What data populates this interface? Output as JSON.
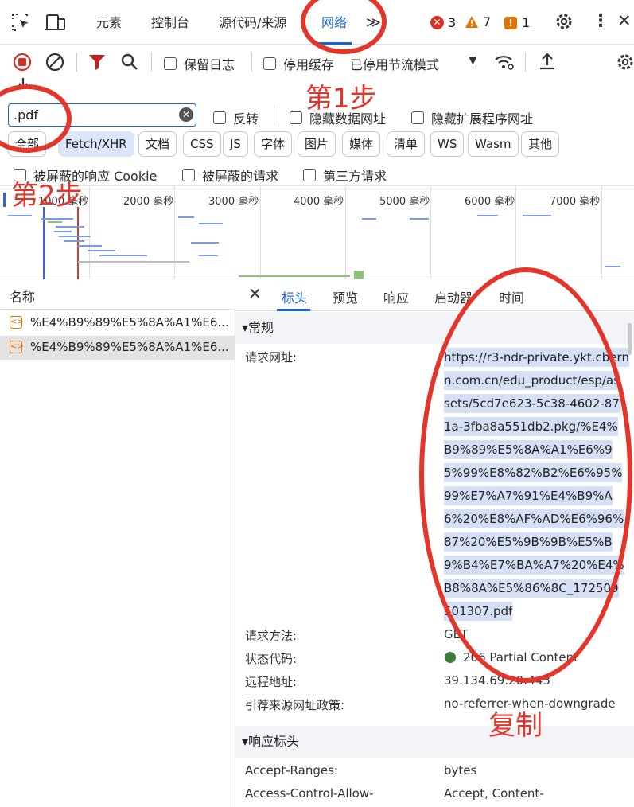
{
  "toolbar": {
    "tabs": [
      "元素",
      "控制台",
      "源代码/来源",
      "网络"
    ],
    "active_tab": "网络",
    "errors": "3",
    "warnings": "7",
    "issues": "1"
  },
  "network_toolbar": {
    "preserve_log": "保留日志",
    "disable_cache": "停用缓存",
    "throttling": "已停用节流模式"
  },
  "filter": {
    "value": ".pdf",
    "invert": "反转",
    "hide_data_urls": "隐藏数据网址",
    "hide_ext_urls": "隐藏扩展程序网址",
    "types": [
      "全部",
      "Fetch/XHR",
      "文档",
      "CSS",
      "JS",
      "字体",
      "图片",
      "媒体",
      "清单",
      "WS",
      "Wasm",
      "其他"
    ],
    "active_type": "Fetch/XHR",
    "blocked_cookies": "被屏蔽的响应 Cookie",
    "blocked_requests": "被屏蔽的请求",
    "third_party": "第三方请求"
  },
  "timeline": {
    "ticks": [
      "1000 毫秒",
      "2000 毫秒",
      "3000 毫秒",
      "4000 毫秒",
      "5000 毫秒",
      "6000 毫秒",
      "7000 毫秒"
    ]
  },
  "request_list": {
    "header": "名称",
    "rows": [
      "%E4%B9%89%E5%8A%A1%E6...",
      "%E4%B9%89%E5%8A%A1%E6..."
    ]
  },
  "details": {
    "tabs": [
      "标头",
      "预览",
      "响应",
      "启动器",
      "时间"
    ],
    "active_tab": "标头",
    "general": {
      "title": "▾常规",
      "url_label": "请求网址:",
      "url_lines": [
        "https://r3-ndr-private.ykt.cbern",
        "n.com.cn/edu_product/esp/as",
        "sets/5cd7e623-5c38-4602-87",
        "1a-3fba8a551db2.pkg/%E4%",
        "B9%89%E5%8A%A1%E6%9",
        "5%99%E8%82%B2%E6%95%",
        "99%E7%A7%91%E4%B9%A",
        "6%20%E8%AF%AD%E6%96%",
        "87%20%E5%9B%9B%E5%B",
        "9%B4%E7%BA%A7%20%E4%",
        "B8%8A%E5%86%8C_172509",
        "501307.pdf"
      ],
      "method_label": "请求方法:",
      "method": "GET",
      "status_label": "状态代码:",
      "status": "206 Partial Content",
      "status_color": "#3f7c3a",
      "remote_label": "远程地址:",
      "remote": "39.134.69.20:443",
      "referrer_label": "引荐来源网址政策:",
      "referrer": "no-referrer-when-downgrade"
    },
    "response_headers": {
      "title": "▾响应标头",
      "rows": [
        {
          "k": "Accept-Ranges:",
          "v": "bytes"
        },
        {
          "k": "Access-Control-Allow-",
          "v": "Accept, Content-"
        }
      ]
    }
  },
  "annotations": {
    "step1": "第1步",
    "step2": "第2步",
    "copy": "复制",
    "color": "#e4352b"
  }
}
